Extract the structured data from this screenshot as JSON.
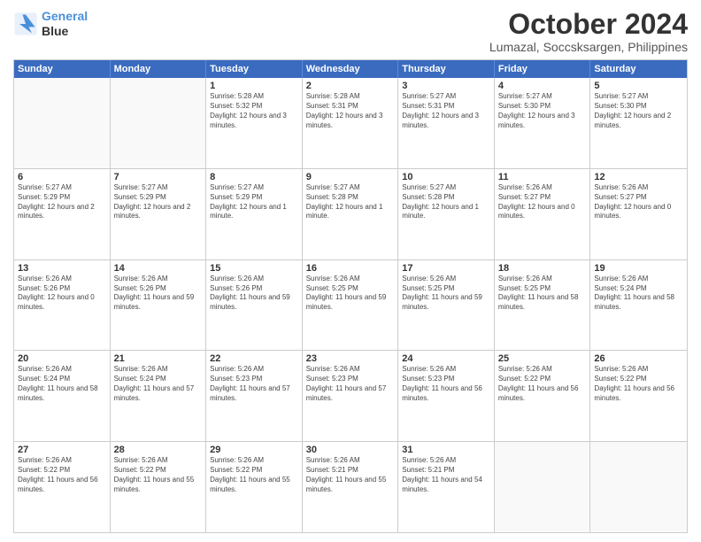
{
  "header": {
    "logo_line1": "General",
    "logo_line2": "Blue",
    "title": "October 2024",
    "subtitle": "Lumazal, Soccsksargen, Philippines"
  },
  "calendar": {
    "days_of_week": [
      "Sunday",
      "Monday",
      "Tuesday",
      "Wednesday",
      "Thursday",
      "Friday",
      "Saturday"
    ],
    "weeks": [
      [
        {
          "day": "",
          "info": ""
        },
        {
          "day": "",
          "info": ""
        },
        {
          "day": "1",
          "info": "Sunrise: 5:28 AM\nSunset: 5:32 PM\nDaylight: 12 hours and 3 minutes."
        },
        {
          "day": "2",
          "info": "Sunrise: 5:28 AM\nSunset: 5:31 PM\nDaylight: 12 hours and 3 minutes."
        },
        {
          "day": "3",
          "info": "Sunrise: 5:27 AM\nSunset: 5:31 PM\nDaylight: 12 hours and 3 minutes."
        },
        {
          "day": "4",
          "info": "Sunrise: 5:27 AM\nSunset: 5:30 PM\nDaylight: 12 hours and 3 minutes."
        },
        {
          "day": "5",
          "info": "Sunrise: 5:27 AM\nSunset: 5:30 PM\nDaylight: 12 hours and 2 minutes."
        }
      ],
      [
        {
          "day": "6",
          "info": "Sunrise: 5:27 AM\nSunset: 5:29 PM\nDaylight: 12 hours and 2 minutes."
        },
        {
          "day": "7",
          "info": "Sunrise: 5:27 AM\nSunset: 5:29 PM\nDaylight: 12 hours and 2 minutes."
        },
        {
          "day": "8",
          "info": "Sunrise: 5:27 AM\nSunset: 5:29 PM\nDaylight: 12 hours and 1 minute."
        },
        {
          "day": "9",
          "info": "Sunrise: 5:27 AM\nSunset: 5:28 PM\nDaylight: 12 hours and 1 minute."
        },
        {
          "day": "10",
          "info": "Sunrise: 5:27 AM\nSunset: 5:28 PM\nDaylight: 12 hours and 1 minute."
        },
        {
          "day": "11",
          "info": "Sunrise: 5:26 AM\nSunset: 5:27 PM\nDaylight: 12 hours and 0 minutes."
        },
        {
          "day": "12",
          "info": "Sunrise: 5:26 AM\nSunset: 5:27 PM\nDaylight: 12 hours and 0 minutes."
        }
      ],
      [
        {
          "day": "13",
          "info": "Sunrise: 5:26 AM\nSunset: 5:26 PM\nDaylight: 12 hours and 0 minutes."
        },
        {
          "day": "14",
          "info": "Sunrise: 5:26 AM\nSunset: 5:26 PM\nDaylight: 11 hours and 59 minutes."
        },
        {
          "day": "15",
          "info": "Sunrise: 5:26 AM\nSunset: 5:26 PM\nDaylight: 11 hours and 59 minutes."
        },
        {
          "day": "16",
          "info": "Sunrise: 5:26 AM\nSunset: 5:25 PM\nDaylight: 11 hours and 59 minutes."
        },
        {
          "day": "17",
          "info": "Sunrise: 5:26 AM\nSunset: 5:25 PM\nDaylight: 11 hours and 59 minutes."
        },
        {
          "day": "18",
          "info": "Sunrise: 5:26 AM\nSunset: 5:25 PM\nDaylight: 11 hours and 58 minutes."
        },
        {
          "day": "19",
          "info": "Sunrise: 5:26 AM\nSunset: 5:24 PM\nDaylight: 11 hours and 58 minutes."
        }
      ],
      [
        {
          "day": "20",
          "info": "Sunrise: 5:26 AM\nSunset: 5:24 PM\nDaylight: 11 hours and 58 minutes."
        },
        {
          "day": "21",
          "info": "Sunrise: 5:26 AM\nSunset: 5:24 PM\nDaylight: 11 hours and 57 minutes."
        },
        {
          "day": "22",
          "info": "Sunrise: 5:26 AM\nSunset: 5:23 PM\nDaylight: 11 hours and 57 minutes."
        },
        {
          "day": "23",
          "info": "Sunrise: 5:26 AM\nSunset: 5:23 PM\nDaylight: 11 hours and 57 minutes."
        },
        {
          "day": "24",
          "info": "Sunrise: 5:26 AM\nSunset: 5:23 PM\nDaylight: 11 hours and 56 minutes."
        },
        {
          "day": "25",
          "info": "Sunrise: 5:26 AM\nSunset: 5:22 PM\nDaylight: 11 hours and 56 minutes."
        },
        {
          "day": "26",
          "info": "Sunrise: 5:26 AM\nSunset: 5:22 PM\nDaylight: 11 hours and 56 minutes."
        }
      ],
      [
        {
          "day": "27",
          "info": "Sunrise: 5:26 AM\nSunset: 5:22 PM\nDaylight: 11 hours and 56 minutes."
        },
        {
          "day": "28",
          "info": "Sunrise: 5:26 AM\nSunset: 5:22 PM\nDaylight: 11 hours and 55 minutes."
        },
        {
          "day": "29",
          "info": "Sunrise: 5:26 AM\nSunset: 5:22 PM\nDaylight: 11 hours and 55 minutes."
        },
        {
          "day": "30",
          "info": "Sunrise: 5:26 AM\nSunset: 5:21 PM\nDaylight: 11 hours and 55 minutes."
        },
        {
          "day": "31",
          "info": "Sunrise: 5:26 AM\nSunset: 5:21 PM\nDaylight: 11 hours and 54 minutes."
        },
        {
          "day": "",
          "info": ""
        },
        {
          "day": "",
          "info": ""
        }
      ]
    ]
  }
}
